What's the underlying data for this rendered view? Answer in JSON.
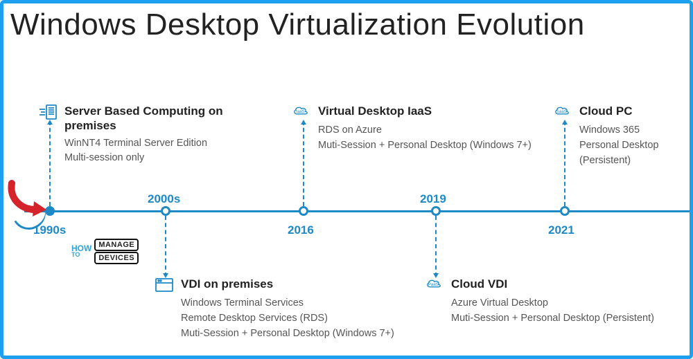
{
  "title": "Windows Desktop Virtualization Evolution",
  "watermark": {
    "how": "HOW",
    "to": "TO",
    "manage": "MANAGE",
    "devices": "DEVICES"
  },
  "years": {
    "y1": "1990s",
    "y2": "2000s",
    "y3": "2016",
    "y4": "2019",
    "y5": "2021"
  },
  "blocks": {
    "b1": {
      "icon": "server-lines",
      "title": "Server Based Computing on premises",
      "line1": "WinNT4 Terminal Server Edition",
      "line2": "Multi-session only"
    },
    "b2": {
      "icon": "window",
      "title": "VDI on premises",
      "line1": "Windows Terminal Services",
      "line2": "Remote Desktop Services (RDS)",
      "line3": "Muti-Session + Personal Desktop (Windows 7+)"
    },
    "b3": {
      "icon": "cloud-iaas",
      "icon_text": "IaaS",
      "title": "Virtual Desktop IaaS",
      "line1": "RDS on Azure",
      "line2": "Muti-Session + Personal Desktop (Windows 7+)"
    },
    "b4": {
      "icon": "cloud-paas",
      "icon_text": "PaaS",
      "title": "Cloud VDI",
      "line1": "Azure Virtual Desktop",
      "line2": "Muti-Session + Personal Desktop (Persistent)"
    },
    "b5": {
      "icon": "cloud-saas",
      "icon_text": "SaaS",
      "title": "Cloud PC",
      "line1": "Windows 365",
      "line2": "Personal Desktop (Persistent)"
    }
  }
}
